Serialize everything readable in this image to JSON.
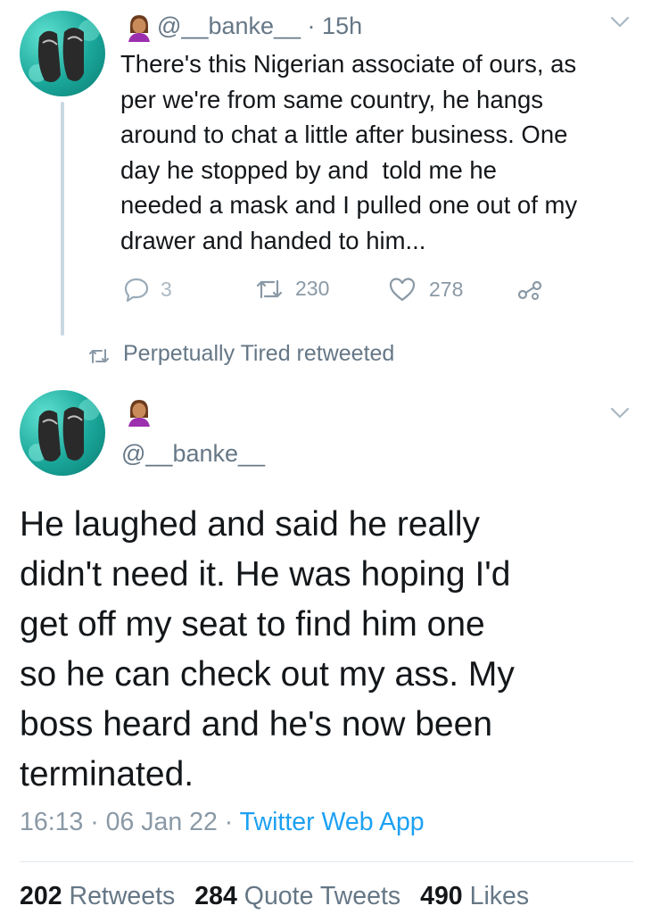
{
  "tweet1": {
    "handle": "@__banke__",
    "time": "15h",
    "text": "There's this Nigerian associate of ours, as\nper we're from same country, he hangs\naround to chat a little after business. One\nday he stopped by and  told me he\nneeded a mask and I pulled one out of my\ndrawer and handed to him...",
    "replies": "3",
    "retweets": "230",
    "likes": "278"
  },
  "retweet_notice": "Perpetually Tired retweeted",
  "tweet2": {
    "handle": "@__banke__",
    "text": "He laughed and said he really\ndidn't need it. He was hoping I'd\nget off my seat to find him one\nso he can check out my ass. My\nboss heard and he's now been\nterminated.",
    "time": "16:13",
    "date": "06 Jan 22",
    "app": "Twitter Web App",
    "stats": {
      "retweets_count": "202",
      "retweets_label": "Retweets",
      "quotes_count": "284",
      "quotes_label": "Quote Tweets",
      "likes_count": "490",
      "likes_label": "Likes"
    }
  },
  "colors": {
    "text": "#14171a",
    "muted": "#657786",
    "link": "#1da1f2",
    "thread_line": "#c9d8e2"
  },
  "icons": [
    "reply-icon",
    "retweet-icon",
    "like-icon",
    "share-icon",
    "chevron-down-icon",
    "person-emoji-icon"
  ]
}
